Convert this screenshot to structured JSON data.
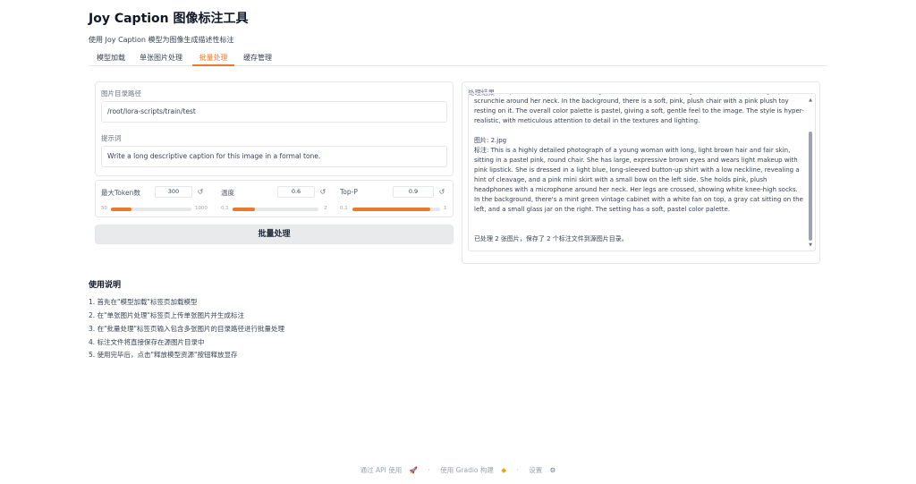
{
  "header": {
    "title": "Joy Caption 图像标注工具",
    "subtitle": "使用 Joy Caption 模型为图像生成描述性标注"
  },
  "tabs": [
    {
      "label": "模型加载"
    },
    {
      "label": "单张图片处理"
    },
    {
      "label": "批量处理",
      "active": true
    },
    {
      "label": "缓存管理"
    }
  ],
  "inputs": {
    "dir_label": "图片目录路径",
    "dir_value": "/root/lora-scripts/train/test",
    "prompt_label": "提示词",
    "prompt_value": "Write a long descriptive caption for this image in a formal tone."
  },
  "sliders": {
    "max_tokens": {
      "label": "最大Token数",
      "value": "300",
      "min": "50",
      "max": "1000",
      "fraction": 0.26
    },
    "temperature": {
      "label": "温度",
      "value": "0.6",
      "min": "0.1",
      "max": "2",
      "fraction": 0.26
    },
    "top_p": {
      "label": "Top-P",
      "value": "0.9",
      "min": "0.1",
      "max": "1",
      "fraction": 0.89
    }
  },
  "batch_button": "批量处理",
  "result": {
    "label": "处理结果",
    "para1": "shoulder top that reveals a white undergarment and a hint of cleavage. Her hands are holding a pink scrunchie around her neck. In the background, there is a soft, pink, plush chair with a pink plush toy resting on it. The overall color palette is pastel, giving a soft, gentle feel to the image. The style is hyper-realistic, with meticulous attention to detail in the textures and lighting.",
    "para2_file": "图片: 2.jpg",
    "para2_caption": "标注: This is a highly detailed photograph of a young woman with long, light brown hair and fair skin, sitting in a pastel pink, round chair. She has large, expressive brown eyes and wears light makeup with pink lipstick. She is dressed in a light blue, long-sleeved button-up shirt with a low neckline, revealing a hint of cleavage, and a pink mini skirt with a small bow on the left side. She holds pink, plush headphones with a microphone around her neck. Her legs are crossed, showing white knee-high socks. In the background, there's a mint green vintage cabinet with a white fan on top, a gray cat sitting on the left, and a small glass jar on the right. The setting has a soft, pastel color palette.",
    "summary": "已处理 2 张图片，保存了 2 个标注文件到源图片目录。"
  },
  "help": {
    "title": "使用说明",
    "items": [
      "1. 首先在\"模型加载\"标签页加载模型",
      "2. 在\"单张图片处理\"标签页上传单张图片并生成标注",
      "3. 在\"批量处理\"标签页输入包含多张图片的目录路径进行批量处理",
      "4. 标注文件将直接保存在源图片目录中",
      "5. 使用完毕后，点击\"释放模型资源\"按钮释放显存"
    ]
  },
  "footer": {
    "api": "通过 API 使用",
    "built": "使用 Gradio 构建",
    "settings": "设置",
    "sep": "·"
  },
  "colors": {
    "accent": "#ea7a2b"
  },
  "icons": {
    "reset": "reset-icon",
    "rocket": "rocket-icon",
    "gradio": "gradio-logo-icon",
    "gear": "gear-icon"
  }
}
